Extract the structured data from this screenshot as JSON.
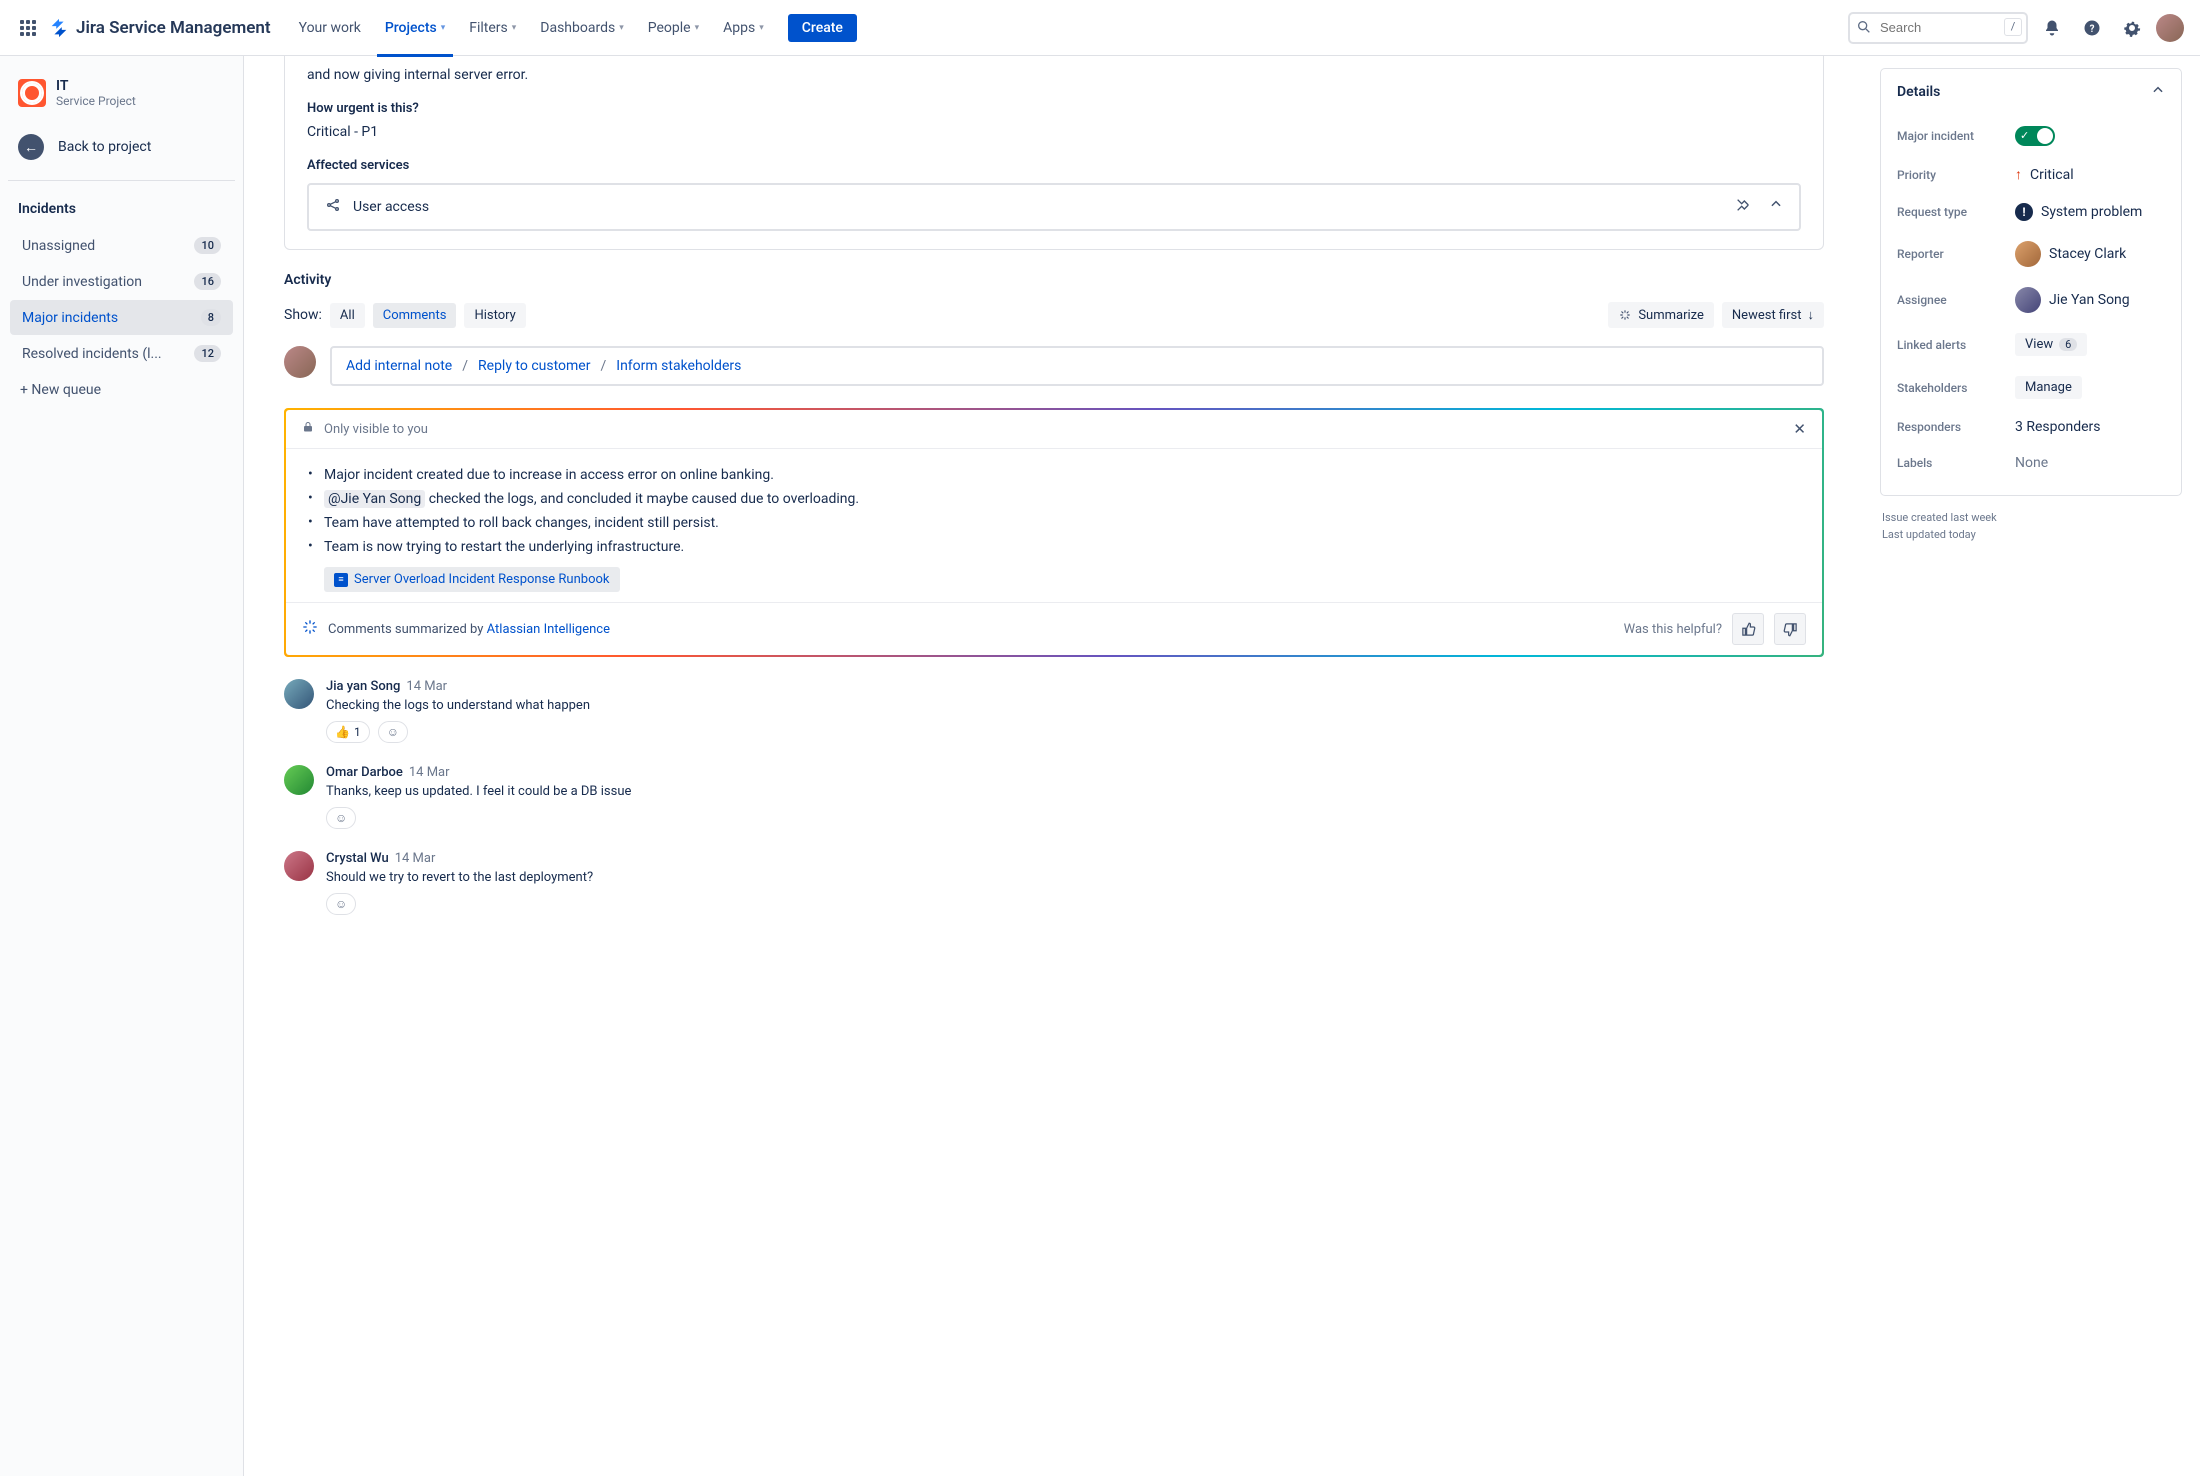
{
  "nav": {
    "product": "Jira Service Management",
    "items": [
      "Your work",
      "Projects",
      "Filters",
      "Dashboards",
      "People",
      "Apps"
    ],
    "create": "Create",
    "search_placeholder": "Search",
    "shortcut": "/"
  },
  "sidebar": {
    "project": {
      "name": "IT",
      "type": "Service Project"
    },
    "back": "Back to project",
    "heading": "Incidents",
    "queues": [
      {
        "label": "Unassigned",
        "count": "10"
      },
      {
        "label": "Under investigation",
        "count": "16"
      },
      {
        "label": "Major incidents",
        "count": "8"
      },
      {
        "label": "Resolved incidents (l...",
        "count": "12"
      }
    ],
    "new_queue": "+ New queue"
  },
  "ticket": {
    "desc_tail": "and now giving internal server error.",
    "urgency_label": "How urgent is this?",
    "urgency_value": "Critical - P1",
    "affected_label": "Affected services",
    "service": "User access"
  },
  "activity": {
    "heading": "Activity",
    "show": "Show:",
    "tabs": [
      "All",
      "Comments",
      "History"
    ],
    "summarize": "Summarize",
    "sort": "Newest first"
  },
  "reply": {
    "internal": "Add internal note",
    "customer": "Reply to customer",
    "stakeholders": "Inform stakeholders"
  },
  "ai": {
    "visibility": "Only visible to you",
    "bullets_pre": [
      "Major incident created due to increase in access error on online banking."
    ],
    "mention": "@Jie Yan Song",
    "bullet_mention_tail": " checked the logs, and concluded it maybe caused due to overloading.",
    "bullets_post": [
      "Team have attempted to roll back changes, incident still persist.",
      "Team is now trying to restart the underlying infrastructure."
    ],
    "runbook": "Server Overload Incident Response Runbook",
    "summary_by_pre": "Comments summarized by ",
    "summary_by_link": "Atlassian Intelligence",
    "helpful": "Was this helpful?"
  },
  "comments": [
    {
      "author": "Jia yan Song",
      "date": "14 Mar",
      "body": "Checking the logs to understand what happen",
      "reacts": [
        {
          "emoji": "👍",
          "count": "1"
        }
      ],
      "av": "av2"
    },
    {
      "author": "Omar Darboe",
      "date": "14 Mar",
      "body": "Thanks, keep us updated. I feel it could be a DB issue",
      "reacts": [],
      "av": "av3"
    },
    {
      "author": "Crystal Wu",
      "date": "14 Mar",
      "body": "Should we try to revert to the last deployment?",
      "reacts": [],
      "av": "av4"
    }
  ],
  "details": {
    "title": "Details",
    "rows": {
      "major_incident": {
        "label": "Major incident"
      },
      "priority": {
        "label": "Priority",
        "value": "Critical"
      },
      "request_type": {
        "label": "Request type",
        "value": "System problem"
      },
      "reporter": {
        "label": "Reporter",
        "value": "Stacey Clark"
      },
      "assignee": {
        "label": "Assignee",
        "value": "Jie Yan Song"
      },
      "linked_alerts": {
        "label": "Linked alerts",
        "chip": "View",
        "count": "6"
      },
      "stakeholders": {
        "label": "Stakeholders",
        "chip": "Manage"
      },
      "responders": {
        "label": "Responders",
        "value": "3 Responders"
      },
      "labels": {
        "label": "Labels",
        "value": "None"
      }
    },
    "meta": {
      "created": "Issue created last week",
      "updated": "Last updated today"
    }
  }
}
